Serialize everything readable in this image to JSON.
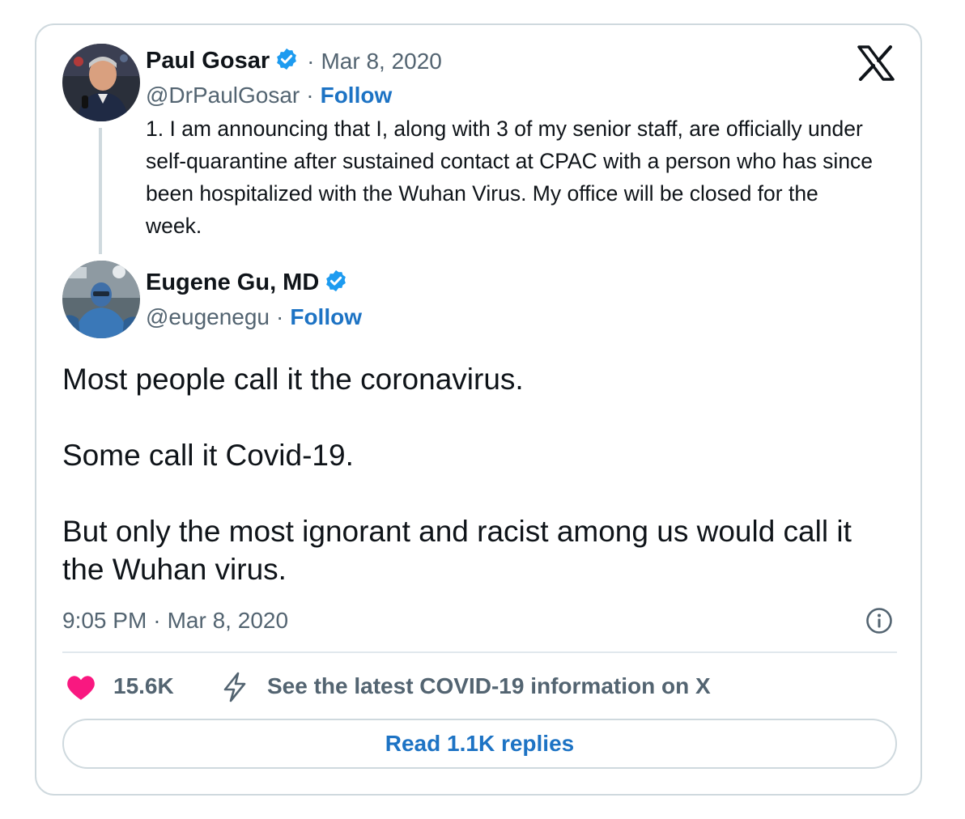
{
  "quoted_tweet": {
    "author_name": "Paul Gosar",
    "date": "Mar 8, 2020",
    "handle": "@DrPaulGosar",
    "follow_label": "Follow",
    "text": "1. I am announcing that I, along with 3 of my senior staff, are officially under self-quarantine after sustained contact at CPAC with a person who has since been hospitalized with the Wuhan Virus.  My office will be closed for the week."
  },
  "main_tweet": {
    "author_name": "Eugene Gu, MD",
    "handle": "@eugenegu",
    "follow_label": "Follow",
    "paragraphs": [
      "Most people call it the coronavirus.",
      "Some call it Covid-19.",
      "But only the most ignorant and racist among us would call it the Wuhan virus."
    ],
    "time": "9:05 PM",
    "date": "Mar 8, 2020"
  },
  "actions": {
    "likes_count": "15.6K",
    "covid_info_label": "See the latest COVID-19 information on X",
    "read_replies_label": "Read 1.1K replies"
  },
  "separator": "·",
  "icons": {
    "brand": "x-logo-icon",
    "verified": "verified-badge-icon",
    "info": "info-icon",
    "like": "heart-icon",
    "covid": "lightning-icon"
  },
  "colors": {
    "link_blue": "#1d73c4",
    "verified_blue": "#1d9bf0",
    "heart_pink": "#f91880",
    "muted_text": "#536471",
    "border": "#cfd9de"
  }
}
